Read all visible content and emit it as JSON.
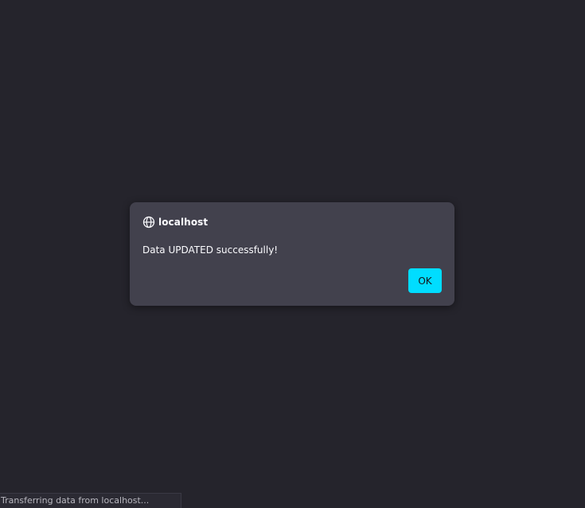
{
  "dialog": {
    "host": "localhost",
    "host_icon": "globe-icon",
    "message": "Data UPDATED successfully!",
    "ok_label": "OK"
  },
  "status_bar": {
    "text": "Transferring data from localhost..."
  },
  "colors": {
    "page_background": "#25242c",
    "dialog_background": "#42414d",
    "accent": "#00ddff",
    "text": "#fbfbfe"
  }
}
